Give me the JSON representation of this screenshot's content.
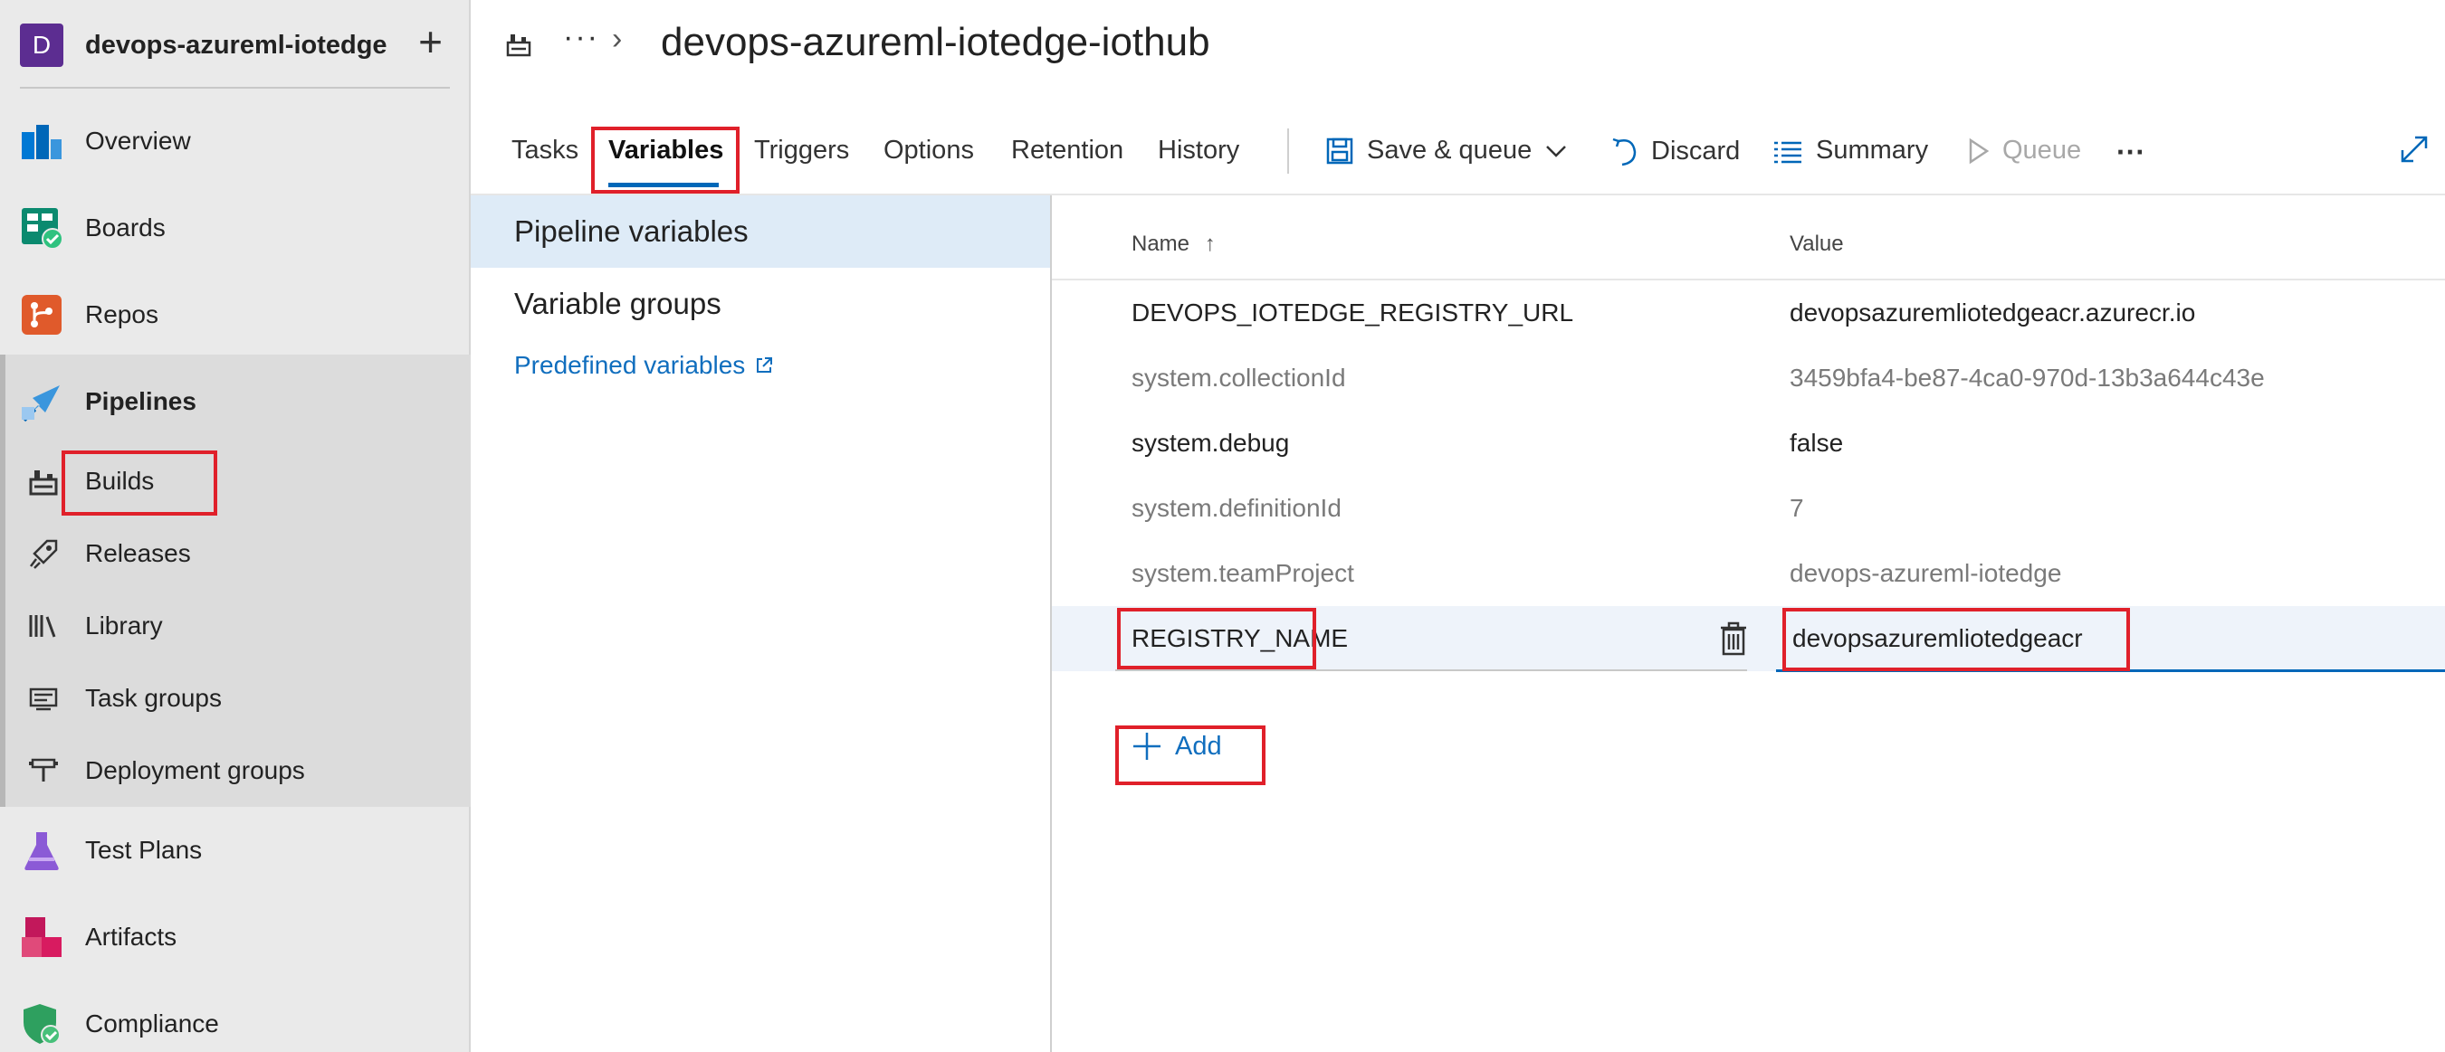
{
  "project": {
    "initial": "D",
    "name": "devops-azureml-iotedge",
    "add_label": "+"
  },
  "nav": {
    "overview": "Overview",
    "boards": "Boards",
    "repos": "Repos",
    "pipelines": "Pipelines",
    "builds": "Builds",
    "releases": "Releases",
    "library": "Library",
    "task_groups": "Task groups",
    "deployment_groups": "Deployment groups",
    "test_plans": "Test Plans",
    "artifacts": "Artifacts",
    "compliance": "Compliance"
  },
  "breadcrumb": {
    "ellipsis": "···",
    "chevron": "›",
    "title": "devops-azureml-iotedge-iothub"
  },
  "tabs": {
    "tasks": "Tasks",
    "variables": "Variables",
    "triggers": "Triggers",
    "options": "Options",
    "retention": "Retention",
    "history": "History"
  },
  "toolbar": {
    "save_queue": "Save & queue",
    "discard": "Discard",
    "summary": "Summary",
    "queue": "Queue",
    "more": "···"
  },
  "left_pane": {
    "pipeline_variables": "Pipeline variables",
    "variable_groups": "Variable groups",
    "predefined_variables": "Predefined variables"
  },
  "table": {
    "header_name": "Name",
    "header_sort_arrow": "↑",
    "header_value": "Value",
    "rows": [
      {
        "name": "DEVOPS_IOTEDGE_REGISTRY_URL",
        "value": "devopsazuremliotedgeacr.azurecr.io"
      },
      {
        "name": "system.collectionId",
        "value": "3459bfa4-be87-4ca0-970d-13b3a644c43e"
      },
      {
        "name": "system.debug",
        "value": "false"
      },
      {
        "name": "system.definitionId",
        "value": "7"
      },
      {
        "name": "system.teamProject",
        "value": "devops-azureml-iotedge"
      },
      {
        "name": "REGISTRY_NAME",
        "value": "devopsazuremliotedgeacr"
      }
    ],
    "add_label": "Add"
  },
  "colors": {
    "accent": "#0067b8",
    "link": "#106ebe",
    "highlight": "#e0202a",
    "project_avatar": "#5c2d91"
  },
  "icons": {
    "breadcrumb": "build-icon",
    "save": "save-icon",
    "discard": "undo-icon",
    "summary": "list-icon",
    "queue": "play-icon",
    "expand": "expand-icon",
    "delete": "trash-icon",
    "add": "plus-icon",
    "external": "external-link-icon"
  }
}
